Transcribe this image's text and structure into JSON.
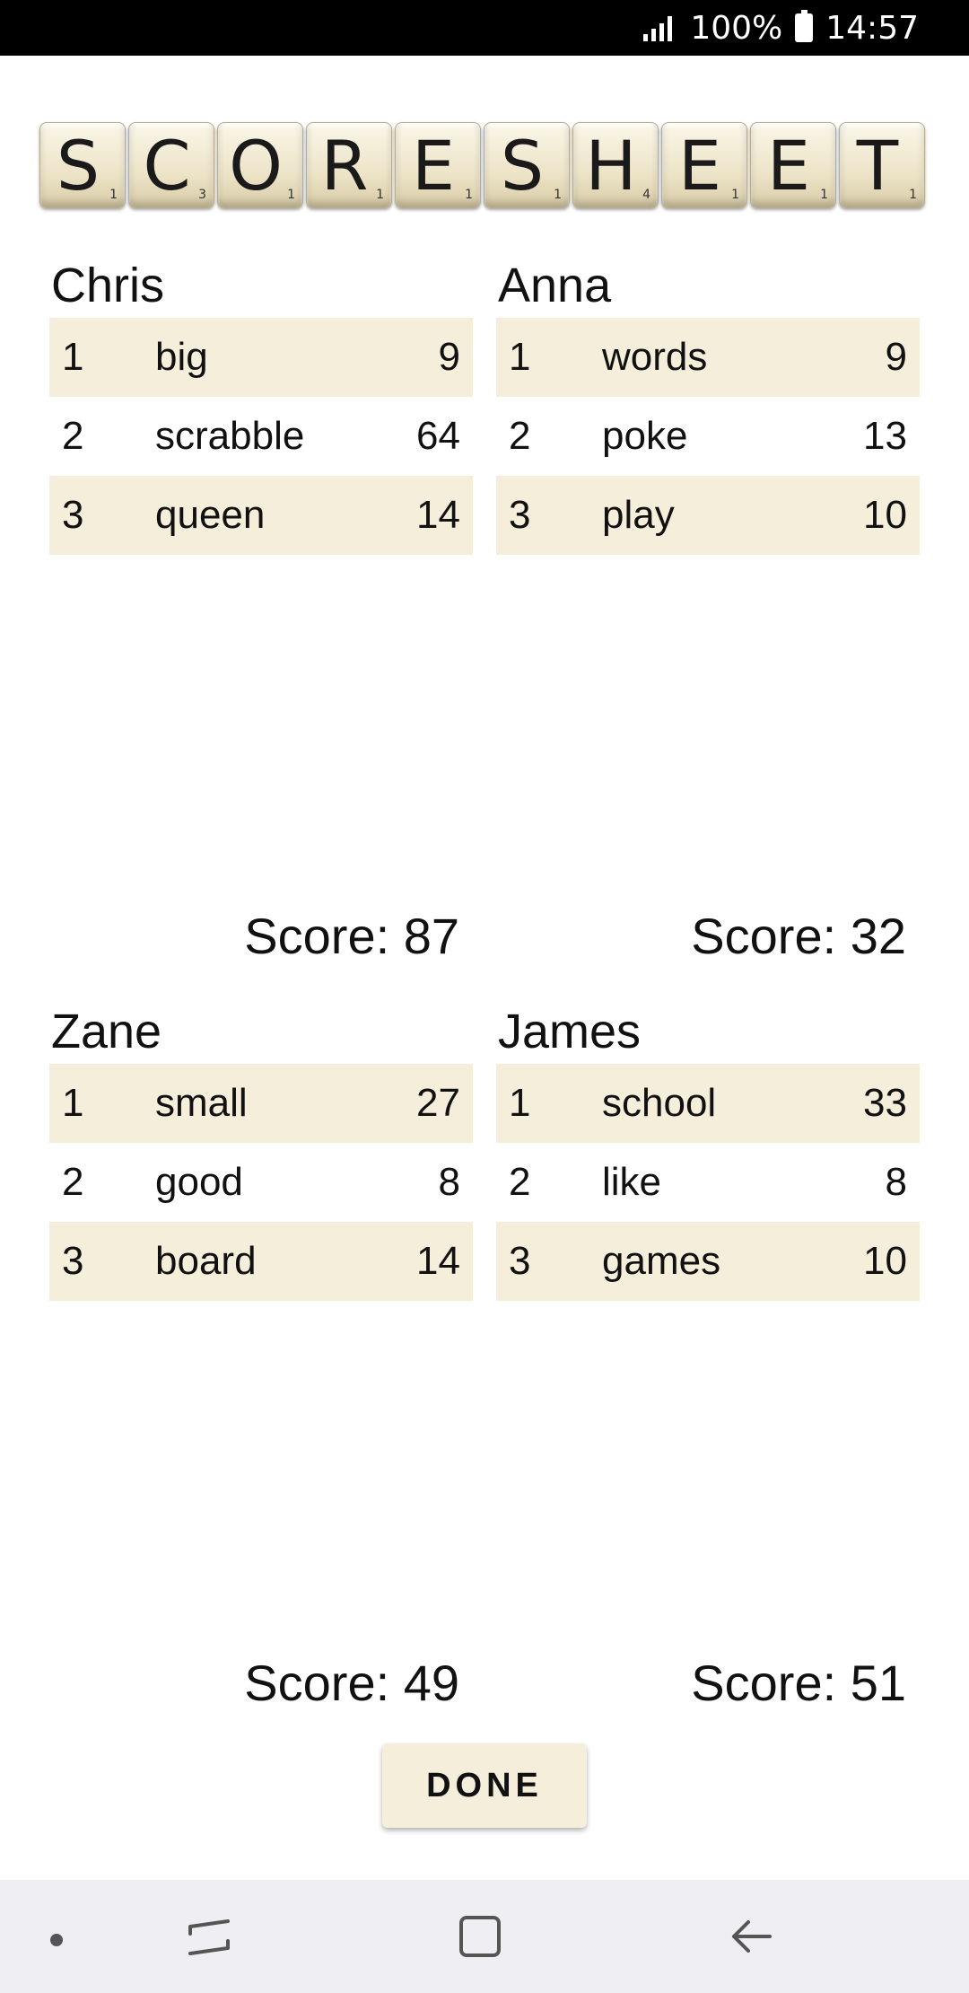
{
  "status_bar": {
    "battery": "100%",
    "time": "14:57"
  },
  "title_tiles": [
    {
      "letter": "S",
      "points": "1"
    },
    {
      "letter": "C",
      "points": "3"
    },
    {
      "letter": "O",
      "points": "1"
    },
    {
      "letter": "R",
      "points": "1"
    },
    {
      "letter": "E",
      "points": "1"
    },
    {
      "letter": "S",
      "points": "1"
    },
    {
      "letter": "H",
      "points": "4"
    },
    {
      "letter": "E",
      "points": "1"
    },
    {
      "letter": "E",
      "points": "1"
    },
    {
      "letter": "T",
      "points": "1"
    }
  ],
  "players": [
    {
      "name": "Chris",
      "score": "Score: 87",
      "rows": [
        {
          "num": "1",
          "word": "big",
          "points": "9"
        },
        {
          "num": "2",
          "word": "scrabble",
          "points": "64"
        },
        {
          "num": "3",
          "word": "queen",
          "points": "14"
        }
      ]
    },
    {
      "name": "Anna",
      "score": "Score: 32",
      "rows": [
        {
          "num": "1",
          "word": "words",
          "points": "9"
        },
        {
          "num": "2",
          "word": "poke",
          "points": "13"
        },
        {
          "num": "3",
          "word": "play",
          "points": "10"
        }
      ]
    },
    {
      "name": "Zane",
      "score": "Score: 49",
      "rows": [
        {
          "num": "1",
          "word": "small",
          "points": "27"
        },
        {
          "num": "2",
          "word": "good",
          "points": "8"
        },
        {
          "num": "3",
          "word": "board",
          "points": "14"
        }
      ]
    },
    {
      "name": "James",
      "score": "Score: 51",
      "rows": [
        {
          "num": "1",
          "word": "school",
          "points": "33"
        },
        {
          "num": "2",
          "word": "like",
          "points": "8"
        },
        {
          "num": "3",
          "word": "games",
          "points": "10"
        }
      ]
    }
  ],
  "done_label": "DONE",
  "colors": {
    "row_shade": "#f5eedb",
    "tile": "#ede4c8",
    "nav_bg": "#efeef2"
  }
}
